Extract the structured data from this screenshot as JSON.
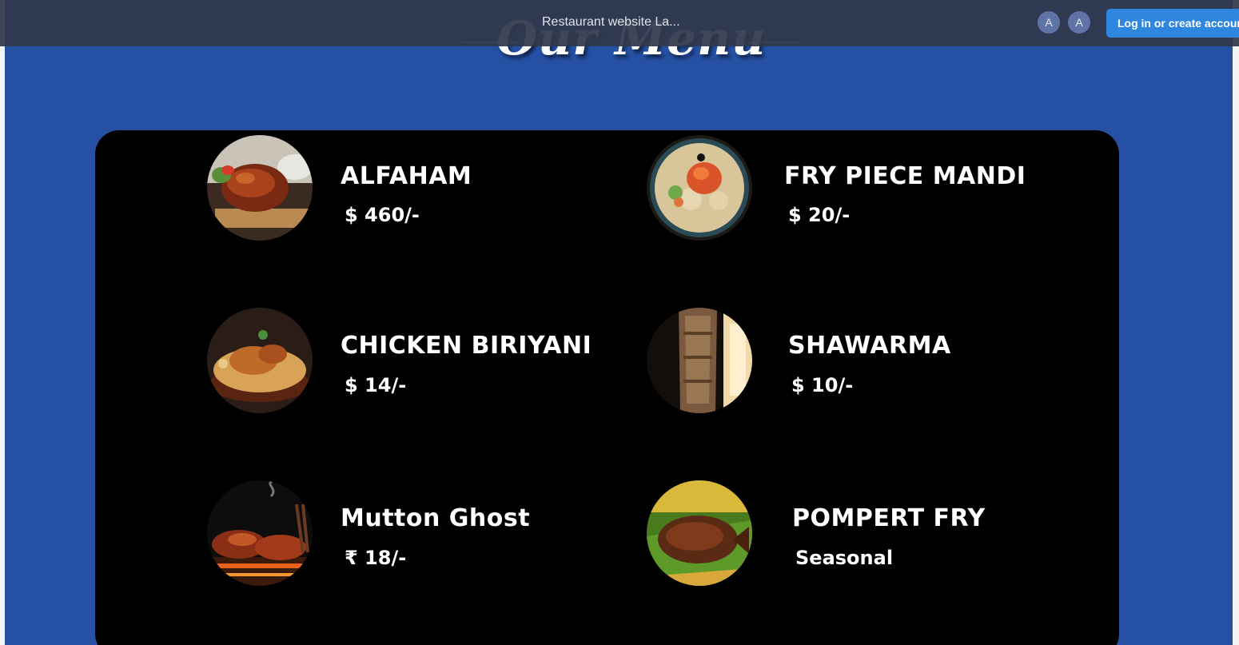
{
  "header": {
    "title": "Restaurant website La...",
    "avatars": [
      "A",
      "A"
    ],
    "login_label": "Log in or create account"
  },
  "section": {
    "heading": "Our Menu"
  },
  "menu": {
    "items": [
      {
        "name": "ALFAHAM",
        "price": "$ 460/-",
        "photo_icon": "grilled-chicken-photo"
      },
      {
        "name": "FRY PIECE MANDI",
        "price": "$ 20/-",
        "photo_icon": "mandi-rice-photo"
      },
      {
        "name": "CHICKEN BIRIYANI",
        "price": "$ 14/-",
        "photo_icon": "biryani-photo"
      },
      {
        "name": "SHAWARMA",
        "price": "$ 10/-",
        "photo_icon": "shawarma-photo"
      },
      {
        "name": "Mutton Ghost",
        "price": "₹ 18/-",
        "photo_icon": "grilled-mutton-photo"
      },
      {
        "name": "POMPERT FRY",
        "price": "Seasonal",
        "photo_icon": "fried-fish-photo"
      }
    ]
  },
  "colors": {
    "page_background": "#2550a3",
    "card_background": "#000000",
    "topbar_background": "#30384a",
    "login_button": "#2f86df"
  }
}
